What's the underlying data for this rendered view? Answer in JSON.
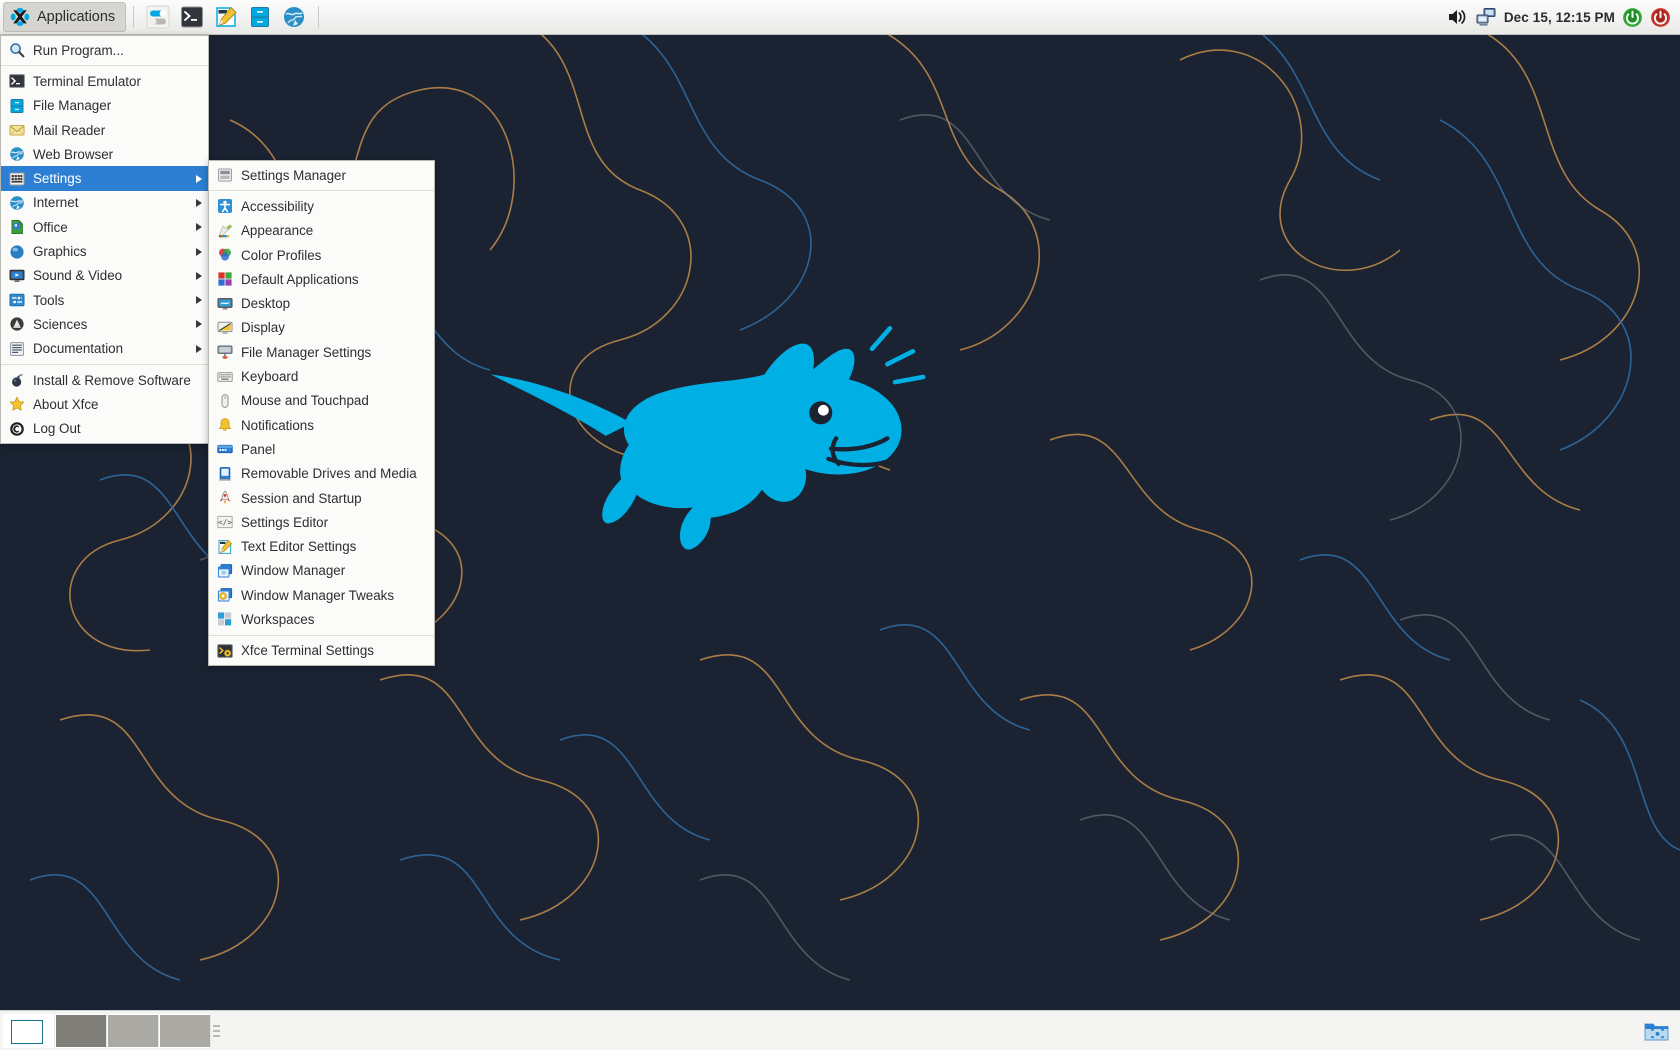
{
  "top_panel": {
    "applications_button": {
      "label": "Applications",
      "icon": "xfce-mouse-icon"
    },
    "launchers": [
      {
        "name": "settings-manager-launcher",
        "icon": "toggle-switch-icon"
      },
      {
        "name": "terminal-launcher",
        "icon": "terminal-icon"
      },
      {
        "name": "text-editor-launcher",
        "icon": "pencil-notepad-icon"
      },
      {
        "name": "file-manager-launcher",
        "icon": "file-cabinet-icon"
      },
      {
        "name": "web-browser-launcher",
        "icon": "globe-icon"
      }
    ],
    "tray": {
      "volume_icon": "speaker-volume-icon",
      "network_icon": "network-workstation-icon",
      "clock": "Dec 15, 12:15 PM",
      "restart_icon": "restart-power-icon",
      "shutdown_icon": "shutdown-power-icon"
    }
  },
  "app_menu": {
    "items": [
      {
        "label": "Run Program...",
        "icon": "magnifier-icon",
        "submenu": false,
        "selected": false
      },
      {
        "separator": true
      },
      {
        "label": "Terminal Emulator",
        "icon": "terminal-icon",
        "submenu": false,
        "selected": false
      },
      {
        "label": "File Manager",
        "icon": "file-cabinet-icon",
        "submenu": false,
        "selected": false
      },
      {
        "label": "Mail Reader",
        "icon": "envelope-icon",
        "submenu": false,
        "selected": false
      },
      {
        "label": "Web Browser",
        "icon": "globe-icon",
        "submenu": false,
        "selected": false
      },
      {
        "label": "Settings",
        "icon": "settings-grid-icon",
        "submenu": true,
        "selected": true
      },
      {
        "label": "Internet",
        "icon": "globe-blue-icon",
        "submenu": true,
        "selected": false
      },
      {
        "label": "Office",
        "icon": "document-icon",
        "submenu": true,
        "selected": false
      },
      {
        "label": "Graphics",
        "icon": "blue-sphere-icon",
        "submenu": true,
        "selected": false
      },
      {
        "label": "Sound & Video",
        "icon": "monitor-media-icon",
        "submenu": true,
        "selected": false
      },
      {
        "label": "Tools",
        "icon": "tools-slider-icon",
        "submenu": true,
        "selected": false
      },
      {
        "label": "Sciences",
        "icon": "flask-dome-icon",
        "submenu": true,
        "selected": false
      },
      {
        "label": "Documentation",
        "icon": "doc-text-icon",
        "submenu": true,
        "selected": false
      },
      {
        "separator": true
      },
      {
        "label": "Install & Remove Software",
        "icon": "package-bomb-icon",
        "submenu": false,
        "selected": false
      },
      {
        "label": "About Xfce",
        "icon": "star-icon",
        "submenu": false,
        "selected": false
      },
      {
        "label": "Log Out",
        "icon": "logout-circle-icon",
        "submenu": false,
        "selected": false
      }
    ]
  },
  "settings_submenu": {
    "items": [
      {
        "label": "Settings Manager",
        "icon": "settings-manager-icon"
      },
      {
        "separator": true
      },
      {
        "label": "Accessibility",
        "icon": "accessibility-icon"
      },
      {
        "label": "Appearance",
        "icon": "appearance-palette-icon"
      },
      {
        "label": "Color Profiles",
        "icon": "color-circles-icon"
      },
      {
        "label": "Default Applications",
        "icon": "four-squares-icon"
      },
      {
        "label": "Desktop",
        "icon": "desktop-monitor-icon"
      },
      {
        "label": "Display",
        "icon": "display-screen-icon"
      },
      {
        "label": "File Manager Settings",
        "icon": "file-manager-settings-icon"
      },
      {
        "label": "Keyboard",
        "icon": "keyboard-icon"
      },
      {
        "label": "Mouse and Touchpad",
        "icon": "mouse-icon"
      },
      {
        "label": "Notifications",
        "icon": "bell-icon"
      },
      {
        "label": "Panel",
        "icon": "panel-bar-icon"
      },
      {
        "label": "Removable Drives and Media",
        "icon": "removable-drive-icon"
      },
      {
        "label": "Session and Startup",
        "icon": "rocket-icon"
      },
      {
        "label": "Settings Editor",
        "icon": "code-brackets-icon"
      },
      {
        "label": "Text Editor Settings",
        "icon": "pencil-notepad-icon"
      },
      {
        "label": "Window Manager",
        "icon": "window-manager-icon"
      },
      {
        "label": "Window Manager Tweaks",
        "icon": "window-tweaks-gear-icon"
      },
      {
        "label": "Workspaces",
        "icon": "workspaces-icon"
      },
      {
        "separator": true
      },
      {
        "label": "Xfce Terminal Settings",
        "icon": "terminal-settings-icon"
      }
    ]
  },
  "bottom_panel": {
    "workspaces": [
      {
        "name": "workspace-1",
        "active": true,
        "has_window": true
      },
      {
        "name": "workspace-2",
        "active": false,
        "has_window": false
      },
      {
        "name": "workspace-3",
        "active": false,
        "has_window": false
      },
      {
        "name": "workspace-4",
        "active": false,
        "has_window": false
      }
    ],
    "show_desktop_icon": "folder-icon"
  },
  "desktop": {
    "wallpaper_icon": "xfce-mouse-logo",
    "colors": {
      "background": "#1b2333",
      "mouse": "#00b0e5",
      "line_orange": "#c28d48",
      "line_blue": "#2f6fa8",
      "line_grey": "#8d959f",
      "accent_selection": "#2d7fd3"
    }
  }
}
